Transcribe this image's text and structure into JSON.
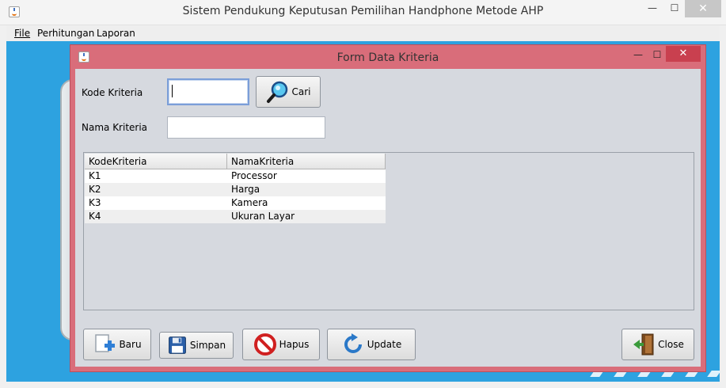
{
  "window": {
    "title": "Sistem Pendukung Keputusan Pemilihan Handphone Metode AHP",
    "minimize": "—",
    "maximize": "☐",
    "close": "✕"
  },
  "menu": {
    "file": "File",
    "perhitungan": "Perhitungan",
    "laporan": "Laporan"
  },
  "form": {
    "title": "Form Data Kriteria",
    "minimize": "—",
    "maximize": "☐",
    "close": "✕",
    "kode_label": "Kode Kriteria",
    "kode_value": "",
    "nama_label": "Nama Kriteria",
    "nama_value": "",
    "search_button": "Cari"
  },
  "table": {
    "columns": [
      "KodeKriteria",
      "NamaKriteria"
    ],
    "rows": [
      [
        "K1",
        "Processor"
      ],
      [
        "K2",
        "Harga"
      ],
      [
        "K3",
        "Kamera"
      ],
      [
        "K4",
        "Ukuran Layar"
      ]
    ]
  },
  "buttons": {
    "baru": "Baru",
    "simpan": "Simpan",
    "hapus": "Hapus",
    "update": "Update",
    "close": "Close"
  },
  "icons": {
    "search": "magnifier-icon",
    "baru": "new-document-icon",
    "simpan": "floppy-disk-icon",
    "hapus": "no-entry-icon",
    "update": "refresh-icon",
    "close": "exit-door-icon"
  },
  "colors": {
    "frame_accent": "#d96d7a",
    "desktop": "#2da2e0"
  }
}
